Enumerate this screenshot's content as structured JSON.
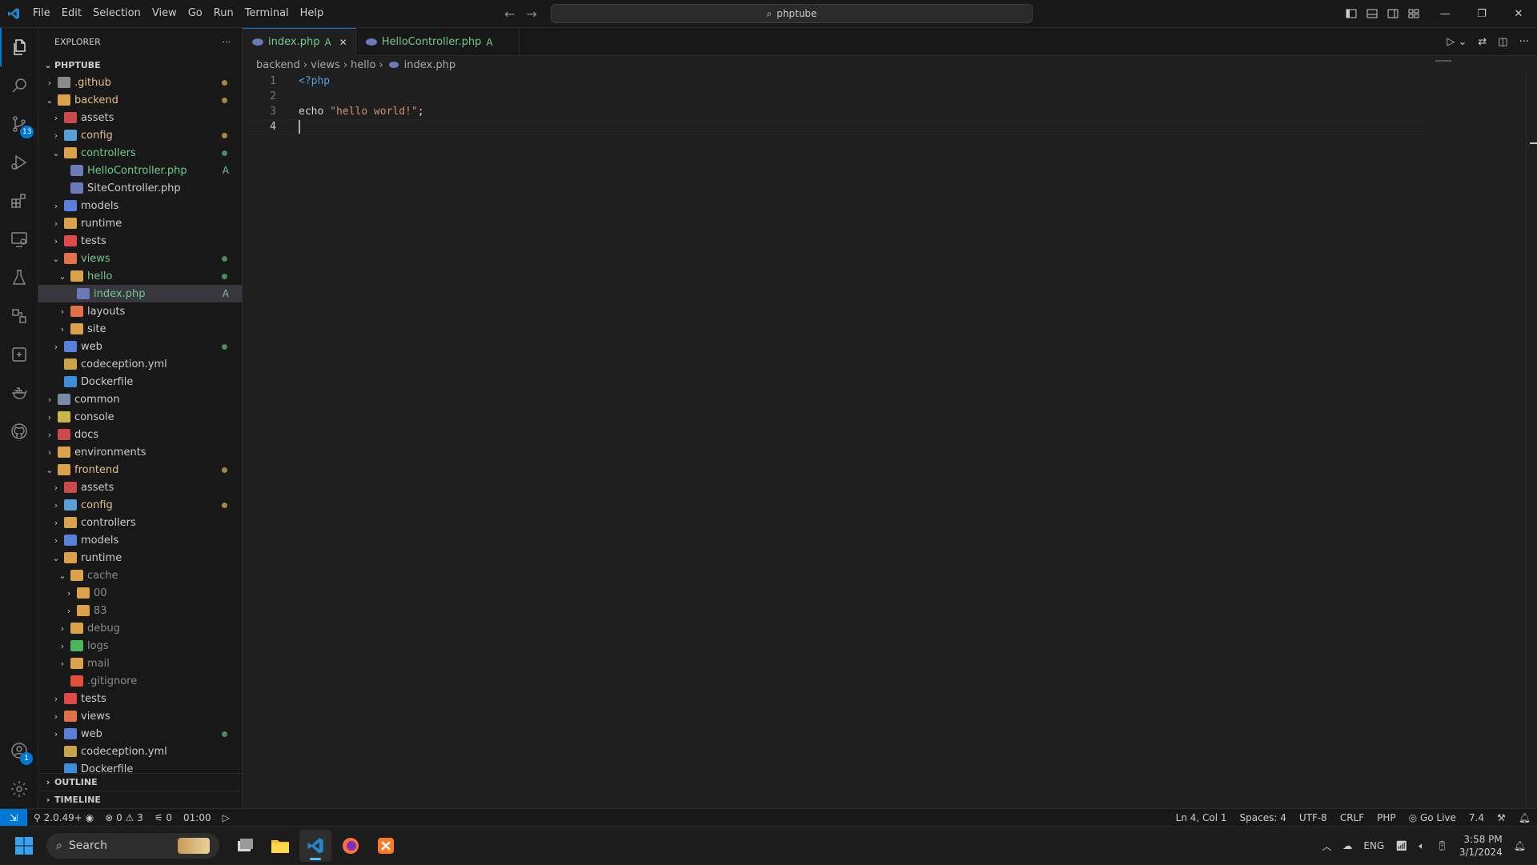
{
  "menu": [
    "File",
    "Edit",
    "Selection",
    "View",
    "Go",
    "Run",
    "Terminal",
    "Help"
  ],
  "command_center": "phptube",
  "explorer": {
    "title": "EXPLORER",
    "more": "···",
    "root": "PHPTUBE",
    "items": [
      {
        "label": ".github",
        "depth": 0,
        "chev": "›",
        "color": "#e2c08d",
        "icon": "#8a8a8a",
        "dot": "#a48a3a"
      },
      {
        "label": "backend",
        "depth": 0,
        "chev": "⌄",
        "color": "#e2c08d",
        "icon": "#d9a24a",
        "dot": "#a48a3a"
      },
      {
        "label": "assets",
        "depth": 1,
        "chev": "›",
        "color": "#cccccc",
        "icon": "#c94b4b",
        "dot": ""
      },
      {
        "label": "config",
        "depth": 1,
        "chev": "›",
        "color": "#e2c08d",
        "icon": "#5aa0d8",
        "dot": "#a48a3a"
      },
      {
        "label": "controllers",
        "depth": 1,
        "chev": "⌄",
        "color": "#73c991",
        "icon": "#d9a24a",
        "dot": "#4f8a5e"
      },
      {
        "label": "HelloController.php",
        "depth": 2,
        "chev": "",
        "color": "#73c991",
        "icon": "#6c7ab8",
        "letter": "A"
      },
      {
        "label": "SiteController.php",
        "depth": 2,
        "chev": "",
        "color": "#cccccc",
        "icon": "#6c7ab8"
      },
      {
        "label": "models",
        "depth": 1,
        "chev": "›",
        "color": "#cccccc",
        "icon": "#5a7fd8"
      },
      {
        "label": "runtime",
        "depth": 1,
        "chev": "›",
        "color": "#cccccc",
        "icon": "#d9a24a"
      },
      {
        "label": "tests",
        "depth": 1,
        "chev": "›",
        "color": "#cccccc",
        "icon": "#e04a4a"
      },
      {
        "label": "views",
        "depth": 1,
        "chev": "⌄",
        "color": "#73c991",
        "icon": "#e0704a",
        "dot": "#4f8a5e"
      },
      {
        "label": "hello",
        "depth": 2,
        "chev": "⌄",
        "color": "#73c991",
        "icon": "#d9a24a",
        "dot": "#4f8a5e"
      },
      {
        "label": "index.php",
        "depth": 3,
        "chev": "",
        "color": "#73c991",
        "icon": "#6c7ab8",
        "letter": "A",
        "selected": true
      },
      {
        "label": "layouts",
        "depth": 2,
        "chev": "›",
        "color": "#cccccc",
        "icon": "#e0704a"
      },
      {
        "label": "site",
        "depth": 2,
        "chev": "›",
        "color": "#cccccc",
        "icon": "#d9a24a"
      },
      {
        "label": "web",
        "depth": 1,
        "chev": "›",
        "color": "#cccccc",
        "icon": "#5a7fd8",
        "dot": "#4f8a5e"
      },
      {
        "label": "codeception.yml",
        "depth": 1,
        "chev": "",
        "color": "#cccccc",
        "icon": "#c9a24a"
      },
      {
        "label": "Dockerfile",
        "depth": 1,
        "chev": "",
        "color": "#cccccc",
        "icon": "#3b8fd8"
      },
      {
        "label": "common",
        "depth": 0,
        "chev": "›",
        "color": "#cccccc",
        "icon": "#7a8aa8"
      },
      {
        "label": "console",
        "depth": 0,
        "chev": "›",
        "color": "#cccccc",
        "icon": "#c9b84a"
      },
      {
        "label": "docs",
        "depth": 0,
        "chev": "›",
        "color": "#cccccc",
        "icon": "#c94b4b"
      },
      {
        "label": "environments",
        "depth": 0,
        "chev": "›",
        "color": "#cccccc",
        "icon": "#d9a24a"
      },
      {
        "label": "frontend",
        "depth": 0,
        "chev": "⌄",
        "color": "#e2c08d",
        "icon": "#d9a24a",
        "dot": "#a48a3a"
      },
      {
        "label": "assets",
        "depth": 1,
        "chev": "›",
        "color": "#cccccc",
        "icon": "#c94b4b"
      },
      {
        "label": "config",
        "depth": 1,
        "chev": "›",
        "color": "#e2c08d",
        "icon": "#5aa0d8",
        "dot": "#a48a3a"
      },
      {
        "label": "controllers",
        "depth": 1,
        "chev": "›",
        "color": "#cccccc",
        "icon": "#d9a24a"
      },
      {
        "label": "models",
        "depth": 1,
        "chev": "›",
        "color": "#cccccc",
        "icon": "#5a7fd8"
      },
      {
        "label": "runtime",
        "depth": 1,
        "chev": "⌄",
        "color": "#cccccc",
        "icon": "#d9a24a"
      },
      {
        "label": "cache",
        "depth": 2,
        "chev": "⌄",
        "color": "#8c8c8c",
        "icon": "#d9a24a"
      },
      {
        "label": "00",
        "depth": 3,
        "chev": "›",
        "color": "#8c8c8c",
        "icon": "#d9a24a"
      },
      {
        "label": "83",
        "depth": 3,
        "chev": "›",
        "color": "#8c8c8c",
        "icon": "#d9a24a"
      },
      {
        "label": "debug",
        "depth": 2,
        "chev": "›",
        "color": "#8c8c8c",
        "icon": "#d9a24a"
      },
      {
        "label": "logs",
        "depth": 2,
        "chev": "›",
        "color": "#8c8c8c",
        "icon": "#4ab85a"
      },
      {
        "label": "mail",
        "depth": 2,
        "chev": "›",
        "color": "#8c8c8c",
        "icon": "#d9a24a"
      },
      {
        "label": ".gitignore",
        "depth": 2,
        "chev": "",
        "color": "#8c8c8c",
        "icon": "#e0503a"
      },
      {
        "label": "tests",
        "depth": 1,
        "chev": "›",
        "color": "#cccccc",
        "icon": "#e04a4a"
      },
      {
        "label": "views",
        "depth": 1,
        "chev": "›",
        "color": "#cccccc",
        "icon": "#e0704a"
      },
      {
        "label": "web",
        "depth": 1,
        "chev": "›",
        "color": "#cccccc",
        "icon": "#5a7fd8",
        "dot": "#4f8a5e"
      },
      {
        "label": "codeception.yml",
        "depth": 1,
        "chev": "",
        "color": "#cccccc",
        "icon": "#c9a24a"
      },
      {
        "label": "Dockerfile",
        "depth": 1,
        "chev": "",
        "color": "#cccccc",
        "icon": "#3b8fd8"
      }
    ],
    "outline": "OUTLINE",
    "timeline": "TIMELINE"
  },
  "tabs": [
    {
      "label": "index.php",
      "status": "A",
      "active": true,
      "close": "✕"
    },
    {
      "label": "HelloController.php",
      "status": "A",
      "active": false,
      "close": ""
    }
  ],
  "breadcrumb": [
    "backend",
    "views",
    "hello",
    "index.php"
  ],
  "code": [
    {
      "n": "1",
      "tokens": [
        {
          "t": "<?php",
          "c": "kw-tag"
        }
      ]
    },
    {
      "n": "2",
      "tokens": []
    },
    {
      "n": "3",
      "tokens": [
        {
          "t": "echo ",
          "c": "pl"
        },
        {
          "t": "\"hello world!\"",
          "c": "str"
        },
        {
          "t": ";",
          "c": "pl"
        }
      ]
    },
    {
      "n": "4",
      "tokens": [],
      "current": true
    }
  ],
  "activity_badges": {
    "scm": "13",
    "accounts": "1"
  },
  "status": {
    "branch_info": "2.0.49+",
    "errors": "0",
    "warnings": "3",
    "ports": "0",
    "time": "01:00",
    "position": "Ln 4, Col 1",
    "spaces": "Spaces: 4",
    "encoding": "UTF-8",
    "eol": "CRLF",
    "language": "PHP",
    "golive": "Go Live",
    "version": "7.4"
  },
  "taskbar": {
    "search": "Search",
    "lang": "ENG",
    "time": "3:58 PM",
    "date": "3/1/2024"
  }
}
